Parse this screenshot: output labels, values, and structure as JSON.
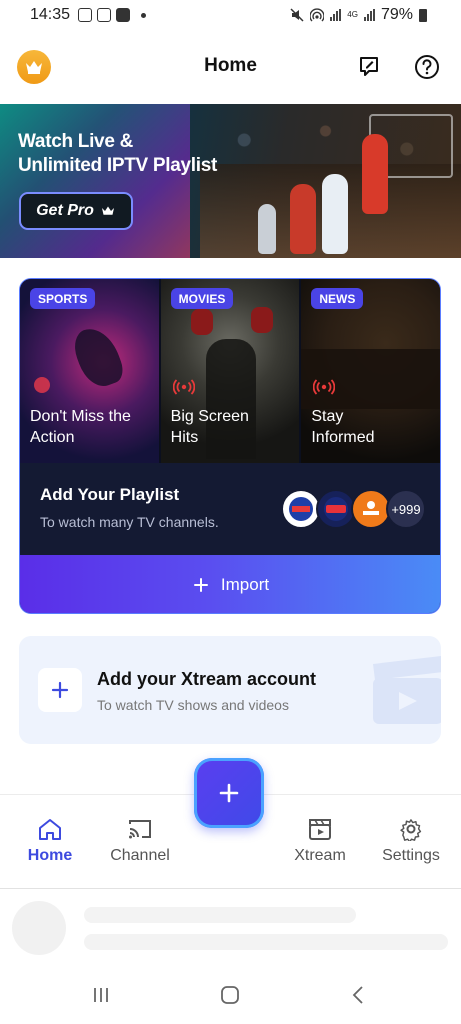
{
  "status_bar": {
    "time": "14:35",
    "network": "4G",
    "battery": "79%"
  },
  "header": {
    "title": "Home",
    "crown_icon": "crown-icon",
    "edit_icon": "edit-note-icon",
    "help_icon": "help-circle-icon"
  },
  "promo": {
    "title_line1": "Watch Live &",
    "title_line2": "Unlimited IPTV Playlist",
    "button_label": "Get Pro"
  },
  "playlist_card": {
    "tiles": [
      {
        "tag": "SPORTS",
        "line1": "Don't Miss the",
        "line2": "Action"
      },
      {
        "tag": "MOVIES",
        "line1": "Big Screen",
        "line2": "Hits"
      },
      {
        "tag": "NEWS",
        "line1": "Stay",
        "line2": "Informed"
      }
    ],
    "add_title": "Add Your Playlist",
    "add_subtitle": "To watch many TV channels.",
    "logos": [
      "logo-1",
      "logo-2",
      "logo-3"
    ],
    "more_count": "+999",
    "import_label": "Import"
  },
  "xtream_card": {
    "title": "Add your Xtream account",
    "subtitle": "To watch TV shows and videos"
  },
  "bottom_nav": {
    "items": [
      {
        "label": "Home",
        "icon": "home-icon",
        "active": true
      },
      {
        "label": "Channel",
        "icon": "cast-icon",
        "active": false
      },
      {
        "label": "Xtream",
        "icon": "clapper-icon",
        "active": false
      },
      {
        "label": "Settings",
        "icon": "gear-icon",
        "active": false
      }
    ],
    "fab_icon": "plus-icon"
  },
  "colors": {
    "accent": "#3d4adf",
    "tag_bg": "#4a44e6",
    "crown": "#f5a623",
    "import_gradient_start": "#5a2ee8",
    "import_gradient_end": "#4a8cf6"
  }
}
